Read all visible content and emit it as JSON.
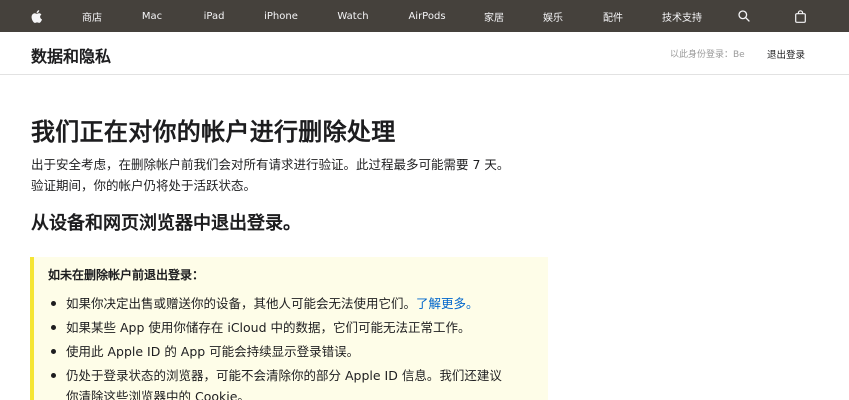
{
  "globalnav": {
    "items": [
      {
        "id": "apple-logo",
        "label": ""
      },
      {
        "id": "store",
        "label": "商店"
      },
      {
        "id": "mac",
        "label": "Mac"
      },
      {
        "id": "ipad",
        "label": "iPad"
      },
      {
        "id": "iphone",
        "label": "iPhone"
      },
      {
        "id": "watch",
        "label": "Watch"
      },
      {
        "id": "airpods",
        "label": "AirPods"
      },
      {
        "id": "home",
        "label": "家居"
      },
      {
        "id": "entertainment",
        "label": "娱乐"
      },
      {
        "id": "accessories",
        "label": "配件"
      },
      {
        "id": "support",
        "label": "技术支持"
      }
    ],
    "icons": {
      "search": "search-icon",
      "bag": "bag-icon",
      "logo": "apple-logo-icon"
    },
    "background": "#45413c"
  },
  "localnav": {
    "title": "数据和隐私",
    "signed_in_as": "以此身份登录：Be",
    "sign_out": "退出登录"
  },
  "main": {
    "heading": "我们正在对你的帐户进行删除处理",
    "intro_lines": [
      "出于安全考虑，在删除帐户前我们会对所有请求进行验证。此过程最多可能需要 7 天。",
      "验证期间，你的帐户仍将处于活跃状态。"
    ],
    "subheading": "从设备和网页浏览器中退出登录。",
    "callout": {
      "title": "如未在删除帐户前退出登录：",
      "items": [
        {
          "lines": [
            "如果你决定出售或赠送你的设备，其他人可能会无法使用它们。"
          ],
          "link": "了解更多。"
        },
        {
          "lines": [
            "如果某些 App 使用你储存在 iCloud 中的数据，它们可能无法正常工作。"
          ]
        },
        {
          "lines": [
            "使用此 Apple ID 的 App 可能会持续显示登录错误。"
          ]
        },
        {
          "lines": [
            "仍处于登录状态的浏览器，可能不会清除你的部分 Apple ID 信息。我们还建议",
            "你清除这些浏览器中的 Cookie。"
          ]
        }
      ],
      "accent": "#f5e534",
      "background": "#fefde8"
    },
    "link_color": "#0066cc"
  }
}
